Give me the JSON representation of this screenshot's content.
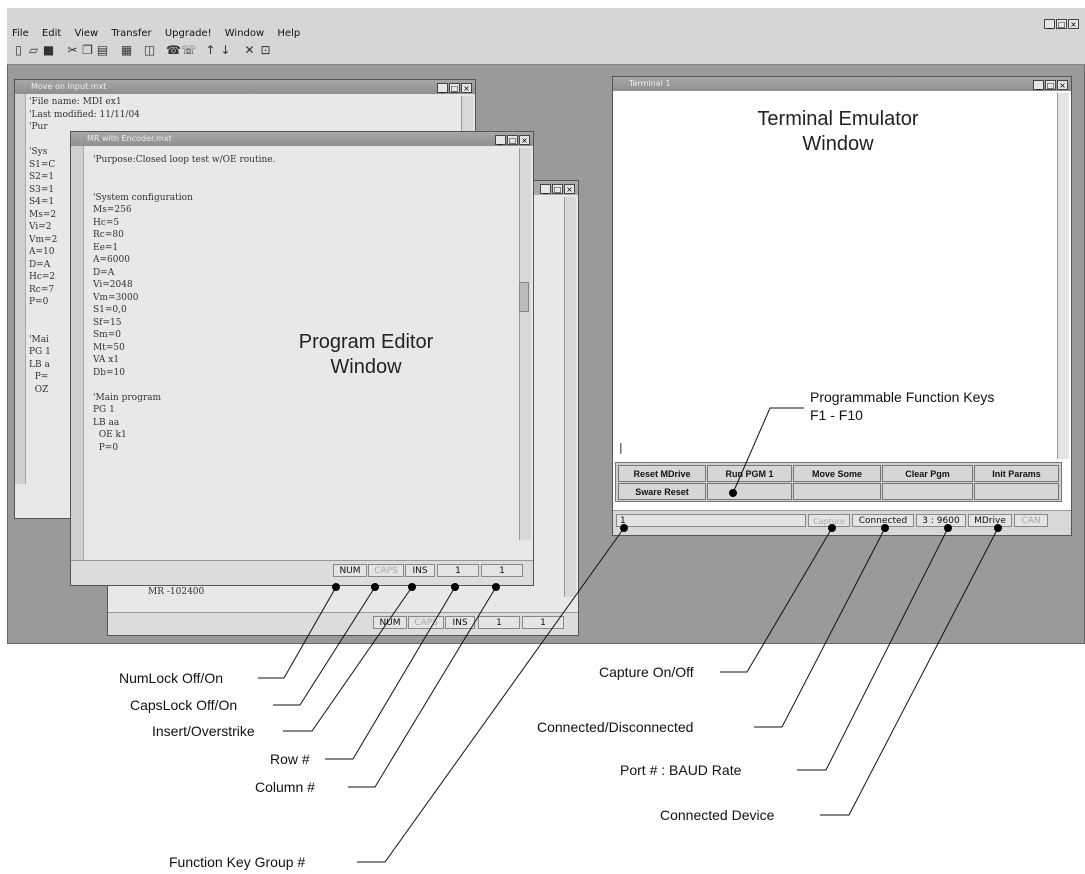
{
  "menu": {
    "items": [
      "File",
      "Edit",
      "View",
      "Transfer",
      "Upgrade!",
      "Window",
      "Help"
    ]
  },
  "app_controls": [
    "_",
    "□",
    "×"
  ],
  "window_controls": [
    "_",
    "□",
    "×"
  ],
  "toolbar": {
    "icons": [
      "new-file-icon",
      "open-folder-icon",
      "save-icon",
      "cut-icon",
      "copy-icon",
      "paste-icon",
      "print-icon",
      "properties-icon",
      "connect-phone-icon",
      "disconnect-phone-icon",
      "upload-arrow-icon",
      "download-arrow-icon",
      "close-icon",
      "window-icon"
    ]
  },
  "windows": {
    "move_on_input": {
      "title": "Move on Input.mxt",
      "lines": [
        "'File name: MDI ex1",
        "'Last modified: 11/11/04",
        "'Pur",
        "",
        "'Sys",
        "S1=C",
        "S2=1",
        "S3=1",
        "S4=1",
        "Ms=2",
        "Vi=2",
        "Vm=2",
        "A=10",
        "D=A",
        "Hc=2",
        "Rc=7",
        "P=0",
        "",
        "",
        "'Mai",
        "PG 1",
        "LB a",
        "  P=",
        "  OZ"
      ]
    },
    "third_editor": {
      "line": "MR -102400",
      "status": {
        "num": "NUM",
        "caps": "CAPS",
        "ins": "INS",
        "row": "1",
        "col": "1"
      }
    },
    "mr_with_encoder": {
      "title": "MR with Encoder.mxt",
      "lines": [
        "'Purpose:Closed loop test w/OE routine.",
        "",
        "",
        "'System configuration",
        "Ms=256",
        "Hc=5",
        "Rc=80",
        "Ee=1",
        "A=6000",
        "D=A",
        "Vi=2048",
        "Vm=3000",
        "S1=0,0",
        "Sf=15",
        "Sm=0",
        "Mt=50",
        "VA x1",
        "Db=10",
        "",
        "'Main program",
        "PG 1",
        "LB aa",
        "  OE k1",
        "  P=0"
      ],
      "label": [
        "Program Editor",
        "Window"
      ],
      "status": {
        "num": "NUM",
        "caps": "CAPS",
        "ins": "INS",
        "row": "1",
        "col": "1"
      }
    },
    "terminal": {
      "title": "Terminal 1",
      "label": [
        "Terminal Emulator",
        "Window"
      ],
      "cursor": "|",
      "function_keys": {
        "row1": [
          "Reset MDrive",
          "Run PGM 1",
          "Move Some",
          "Clear Pgm",
          "Init Params"
        ],
        "row2": [
          "Sware Reset",
          "",
          "",
          "",
          ""
        ]
      },
      "status": {
        "group": "1",
        "capture": "Capture",
        "connected": "Connected",
        "port_baud": "3 : 9600",
        "device": "MDrive",
        "can": "CAN"
      }
    }
  },
  "callouts": {
    "fkeys": [
      "Programmable Function Keys",
      "F1 - F10"
    ],
    "numlock": "NumLock Off/On",
    "capslock": "CapsLock Off/On",
    "insert": "Insert/Overstrike",
    "row": "Row #",
    "column": "Column #",
    "fkgroup": "Function Key Group #",
    "capture": "Capture On/Off",
    "connected": "Connected/Disconnected",
    "port": "Port # : BAUD Rate",
    "device": "Connected Device"
  }
}
